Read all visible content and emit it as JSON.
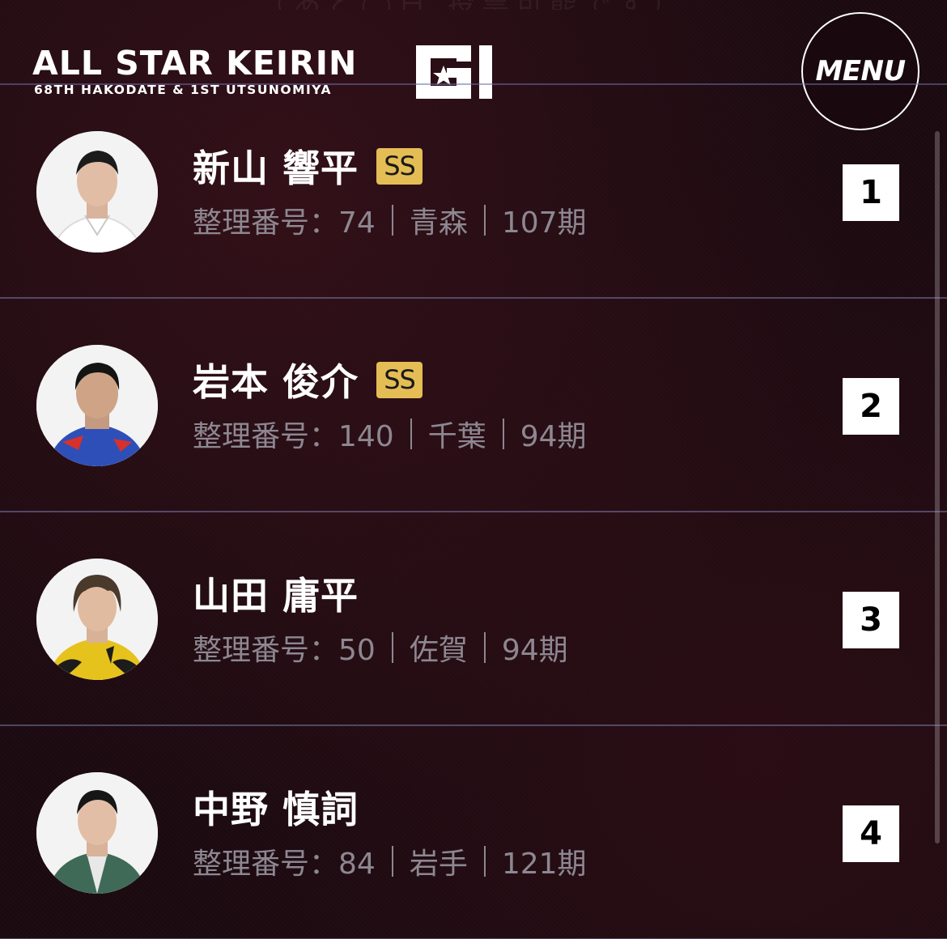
{
  "header": {
    "top_partial_text": "（あと◯日 投票可能です）",
    "logo_title": "ALL STAR KEIRIN",
    "logo_subtitle": "68TH HAKODATE & 1ST UTSUNOMIYA",
    "logo_grade": "GI",
    "menu_label": "MENU"
  },
  "riders": [
    {
      "name": "新山 響平",
      "class_badge": "SS",
      "entry_label": "整理番号：74",
      "prefecture": "青森",
      "term": "107期",
      "rank": "1",
      "jersey_color": "#ffffff"
    },
    {
      "name": "岩本 俊介",
      "class_badge": "SS",
      "entry_label": "整理番号：140",
      "prefecture": "千葉",
      "term": "94期",
      "rank": "2",
      "jersey_color": "#2f4fb8"
    },
    {
      "name": "山田 庸平",
      "class_badge": "",
      "entry_label": "整理番号：50",
      "prefecture": "佐賀",
      "term": "94期",
      "rank": "3",
      "jersey_color": "#e6c21c"
    },
    {
      "name": "中野 慎詞",
      "class_badge": "",
      "entry_label": "整理番号：84",
      "prefecture": "岩手",
      "term": "121期",
      "rank": "4",
      "jersey_color": "#3f6a57"
    }
  ],
  "colors": {
    "badge": "#e5bd55",
    "meta_text": "#8d8790",
    "divider": "#7878aa"
  }
}
